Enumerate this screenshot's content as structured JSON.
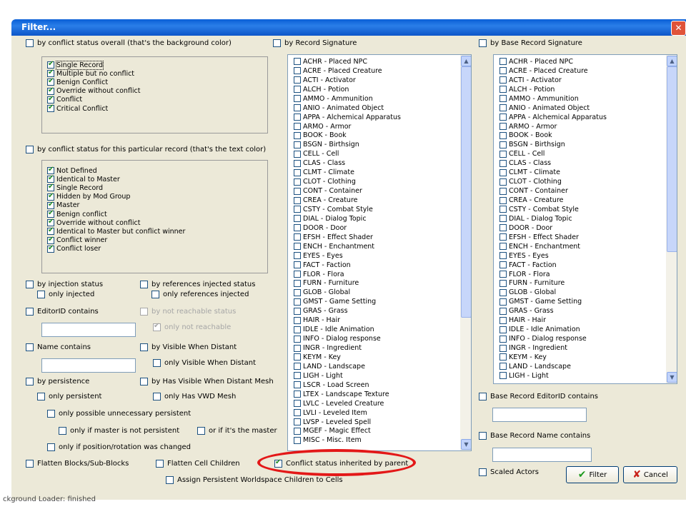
{
  "window": {
    "title": "Filter...",
    "close_icon": "close-icon"
  },
  "status_bar": {
    "text": "ckground Loader: finished"
  },
  "left": {
    "conflict_overall": {
      "label": "by conflict status overall (that's the background color)",
      "items": [
        "Single Record",
        "Multiple but no conflict",
        "Benign Conflict",
        "Override without conflict",
        "Conflict",
        "Critical Conflict"
      ]
    },
    "conflict_record": {
      "label": "by conflict status for this particular record  (that's the text color)",
      "items": [
        "Not Defined",
        "Identical to Master",
        "Single Record",
        "Hidden by Mod Group",
        "Master",
        "Benign conflict",
        "Override without conflict",
        "Identical to Master but conflict winner",
        "Conflict winner",
        "Conflict loser"
      ]
    },
    "injection_status": "by injection status",
    "only_injected": "only injected",
    "refs_injected_status": "by references injected status",
    "only_refs_injected": "only references injected",
    "editorid_contains": "EditorID contains",
    "not_reachable_status": "by not reachable status",
    "only_not_reachable": "only not reachable",
    "name_contains": "Name contains",
    "visible_when_distant": "by Visible When Distant",
    "only_visible_when_distant": "only Visible When Distant",
    "persistence": "by persistence",
    "has_vwd_mesh": "by Has Visible When Distant Mesh",
    "only_persistent": "only persistent",
    "only_has_vwd_mesh": "only Has VWD Mesh",
    "only_possible_unnecessary": "only possible unnecessary persistent",
    "only_master_not_persistent": "only if master is not persistent",
    "or_if_master": "or if it's the master",
    "only_position_changed": "only if position/rotation was changed",
    "flatten_blocks": "Flatten Blocks/Sub-Blocks",
    "flatten_cell_children": "Flatten Cell Children",
    "assign_persistent": "Assign Persistent Worldspace Children to Cells"
  },
  "record_signature": {
    "label": "by Record Signature",
    "items": [
      "ACHR - Placed NPC",
      "ACRE - Placed Creature",
      "ACTI - Activator",
      "ALCH - Potion",
      "AMMO - Ammunition",
      "ANIO - Animated Object",
      "APPA - Alchemical Apparatus",
      "ARMO - Armor",
      "BOOK - Book",
      "BSGN - Birthsign",
      "CELL - Cell",
      "CLAS - Class",
      "CLMT - Climate",
      "CLOT - Clothing",
      "CONT - Container",
      "CREA - Creature",
      "CSTY - Combat Style",
      "DIAL - Dialog Topic",
      "DOOR - Door",
      "EFSH - Effect Shader",
      "ENCH - Enchantment",
      "EYES - Eyes",
      "FACT - Faction",
      "FLOR - Flora",
      "FURN - Furniture",
      "GLOB - Global",
      "GMST - Game Setting",
      "GRAS - Grass",
      "HAIR - Hair",
      "IDLE - Idle Animation",
      "INFO - Dialog response",
      "INGR - Ingredient",
      "KEYM - Key",
      "LAND - Landscape",
      "LIGH - Light",
      "LSCR - Load Screen",
      "LTEX - Landscape Texture",
      "LVLC - Leveled Creature",
      "LVLI - Leveled Item",
      "LVSP - Leveled Spell",
      "MGEF - Magic Effect",
      "MISC - Misc. Item"
    ],
    "conflict_inherited": "Conflict status inherited by parent"
  },
  "base_record_signature": {
    "label": "by Base Record Signature",
    "items": [
      "ACHR - Placed NPC",
      "ACRE - Placed Creature",
      "ACTI - Activator",
      "ALCH - Potion",
      "AMMO - Ammunition",
      "ANIO - Animated Object",
      "APPA - Alchemical Apparatus",
      "ARMO - Armor",
      "BOOK - Book",
      "BSGN - Birthsign",
      "CELL - Cell",
      "CLAS - Class",
      "CLMT - Climate",
      "CLOT - Clothing",
      "CONT - Container",
      "CREA - Creature",
      "CSTY - Combat Style",
      "DIAL - Dialog Topic",
      "DOOR - Door",
      "EFSH - Effect Shader",
      "ENCH - Enchantment",
      "EYES - Eyes",
      "FACT - Faction",
      "FLOR - Flora",
      "FURN - Furniture",
      "GLOB - Global",
      "GMST - Game Setting",
      "GRAS - Grass",
      "HAIR - Hair",
      "IDLE - Idle Animation",
      "INFO - Dialog response",
      "INGR - Ingredient",
      "KEYM - Key",
      "LAND - Landscape",
      "LIGH - Light"
    ],
    "editorid_contains": "Base Record EditorID contains",
    "name_contains": "Base Record Name contains",
    "scaled_actors": "Scaled Actors"
  },
  "buttons": {
    "filter": "Filter",
    "cancel": "Cancel"
  },
  "colors": {
    "titlebar": "#0a5fd6",
    "highlight": "#e31818",
    "check": "#1f8a1f"
  }
}
